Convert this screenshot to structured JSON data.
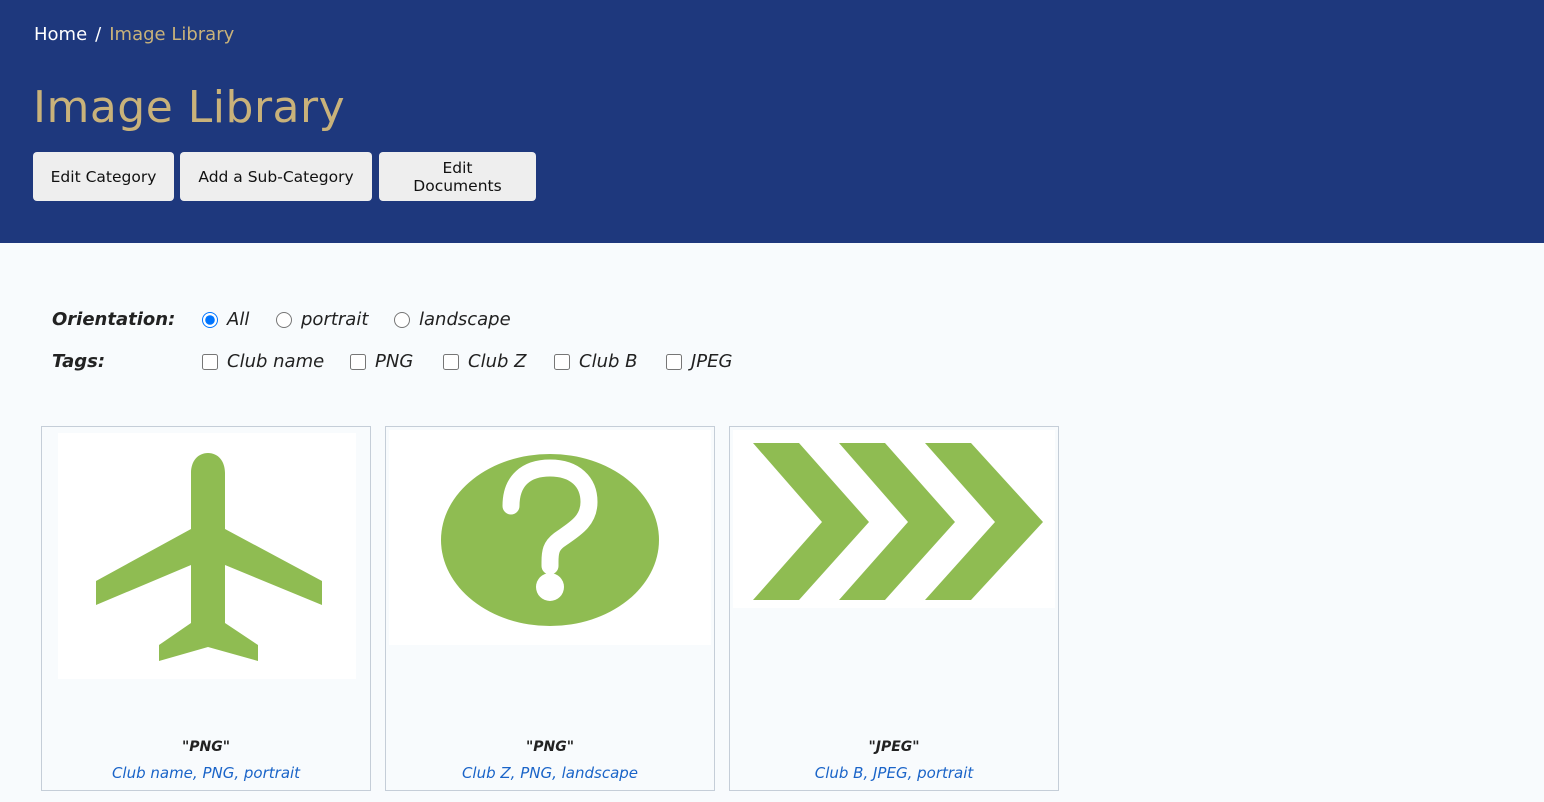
{
  "breadcrumb": {
    "home": "Home",
    "separator": "/",
    "current": "Image Library"
  },
  "page_title": "Image Library",
  "buttons": {
    "edit_category": "Edit Category",
    "add_sub_category": "Add a Sub-Category",
    "edit_documents": "Edit Documents"
  },
  "filters": {
    "orientation": {
      "label": "Orientation:",
      "options": [
        "All",
        "portrait",
        "landscape"
      ],
      "selected": "All"
    },
    "tags": {
      "label": "Tags:",
      "options": [
        "Club name",
        "PNG",
        "Club Z",
        "Club B",
        "JPEG"
      ]
    }
  },
  "cards": [
    {
      "title": "\"PNG\"",
      "tags": [
        "Club name",
        "PNG",
        "portrait"
      ],
      "icon": "airplane-icon"
    },
    {
      "title": "\"PNG\"",
      "tags": [
        "Club Z",
        "PNG",
        "landscape"
      ],
      "icon": "question-mark-icon"
    },
    {
      "title": "\"JPEG\"",
      "tags": [
        "Club B",
        "JPEG",
        "portrait"
      ],
      "icon": "chevrons-icon"
    }
  ],
  "colors": {
    "header_bg": "#1e387d",
    "title_gold": "#c9b27a",
    "icon_green": "#8fbc52",
    "link_blue": "#1a64c8"
  }
}
